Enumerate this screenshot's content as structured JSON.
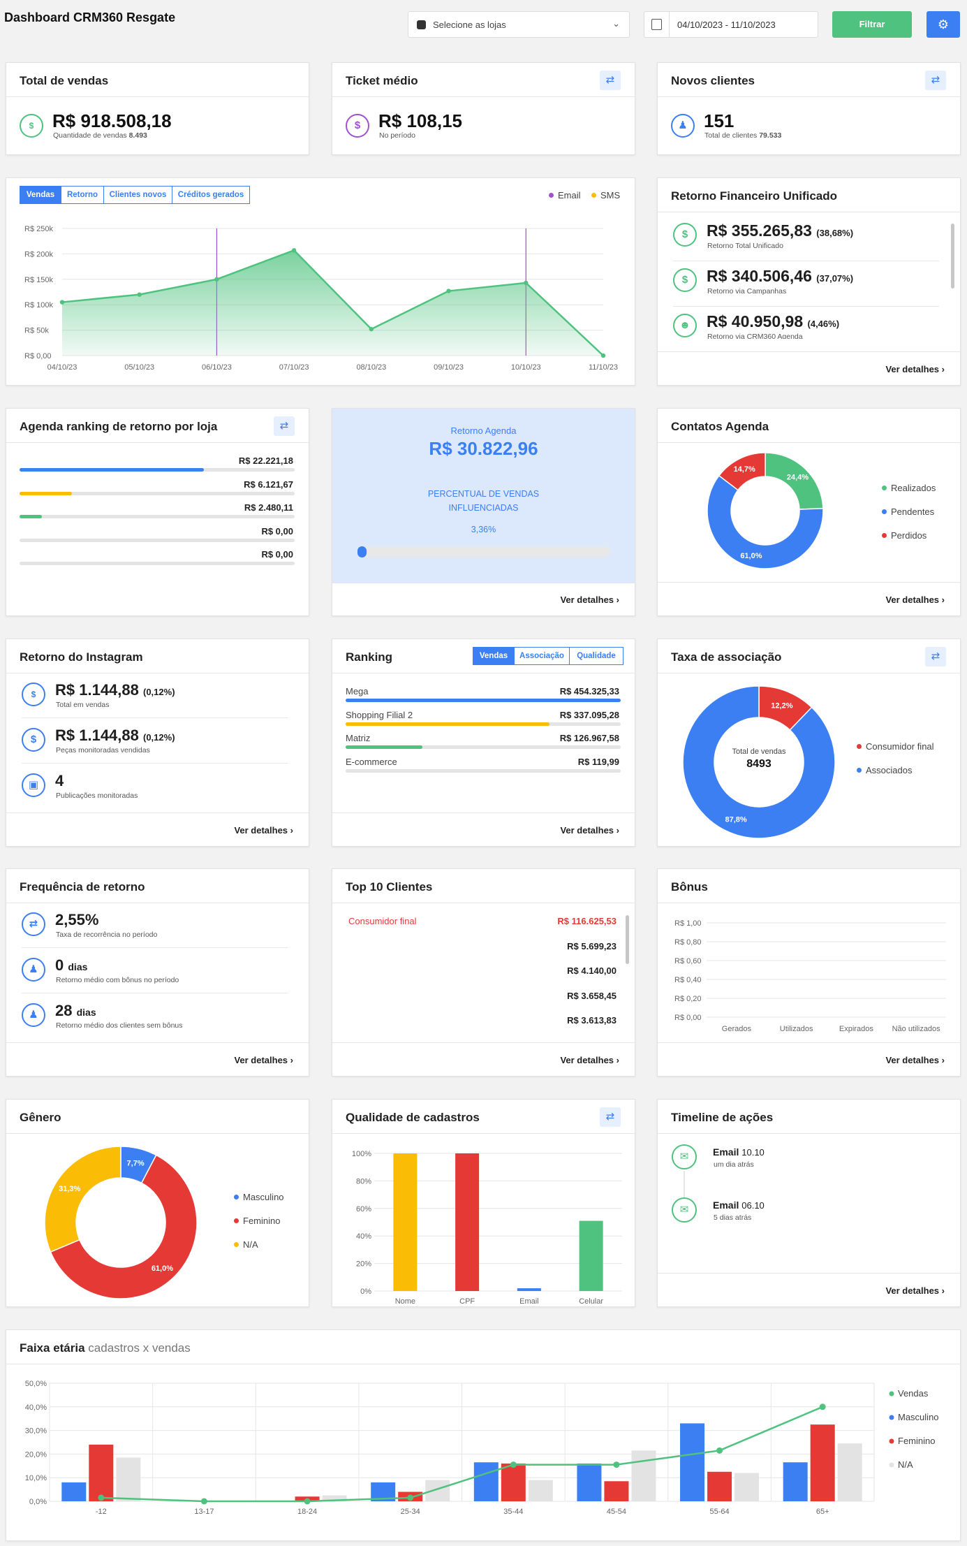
{
  "header": {
    "title": "Dashboard CRM360 Resgate",
    "store_select": "Selecione as lojas",
    "date_range": "04/10/2023 - 11/10/2023",
    "filter_button": "Filtrar"
  },
  "total_vendas": {
    "title": "Total de vendas",
    "value": "R$ 918.508,18",
    "sub_label": "Quantidade de vendas",
    "sub_value": "8.493"
  },
  "ticket": {
    "title": "Ticket médio",
    "value": "R$ 108,15",
    "sub": "No período"
  },
  "novos": {
    "title": "Novos clientes",
    "value": "151",
    "sub_label": "Total de clientes",
    "sub_value": "79.533"
  },
  "vendas_chart": {
    "tabs": [
      "Vendas",
      "Retorno",
      "Clientes novos",
      "Créditos gerados"
    ],
    "legend": [
      "Email",
      "SMS"
    ]
  },
  "retorno_fin": {
    "title": "Retorno Financeiro Unificado",
    "items": [
      {
        "value": "R$ 355.265,83",
        "pct": "(38,68%)",
        "label": "Retorno Total Unificado"
      },
      {
        "value": "R$ 340.506,46",
        "pct": "(37,07%)",
        "label": "Retorno via Campanhas"
      },
      {
        "value": "R$ 40.950,98",
        "pct": "(4,46%)",
        "label": "Retorno via CRM360 Agenda"
      }
    ],
    "more": "Ver detalhes"
  },
  "agenda_rank": {
    "title": "Agenda ranking de retorno por loja",
    "rows": [
      {
        "value": "R$ 22.221,18",
        "pct": 67,
        "color": "#3b7ff2"
      },
      {
        "value": "R$ 6.121,67",
        "pct": 19,
        "color": "#fbbc05"
      },
      {
        "value": "R$ 2.480,11",
        "pct": 8,
        "color": "#4ec27e"
      },
      {
        "value": "R$ 0,00",
        "pct": 0,
        "color": "#3b7ff2"
      },
      {
        "value": "R$ 0,00",
        "pct": 0,
        "color": "#3b7ff2"
      }
    ]
  },
  "retorno_agenda": {
    "label": "Retorno Agenda",
    "value": "R$ 30.822,96",
    "pct_label_1": "PERCENTUAL DE VENDAS",
    "pct_label_2": "INFLUENCIADAS",
    "pct": "3,36%",
    "more": "Ver detalhes"
  },
  "contatos": {
    "title": "Contatos Agenda",
    "legend": [
      "Realizados",
      "Pendentes",
      "Perdidos"
    ],
    "labels": [
      "24,4%",
      "61,0%",
      "14,7%"
    ],
    "more": "Ver detalhes"
  },
  "instagram": {
    "title": "Retorno do Instagram",
    "items": [
      {
        "value": "R$ 1.144,88",
        "pct": "(0,12%)",
        "label": "Total em vendas"
      },
      {
        "value": "R$ 1.144,88",
        "pct": "(0,12%)",
        "label": "Peças monitoradas vendidas"
      },
      {
        "value": "4",
        "pct": "",
        "label": "Publicações monitoradas"
      }
    ],
    "more": "Ver detalhes"
  },
  "ranking": {
    "title": "Ranking",
    "tabs": [
      "Vendas",
      "Associação",
      "Qualidade"
    ],
    "rows": [
      {
        "name": "Mega",
        "value": "R$ 454.325,33",
        "pct": 100,
        "color": "#3b7ff2"
      },
      {
        "name": "Shopping Filial 2",
        "value": "R$ 337.095,28",
        "pct": 74,
        "color": "#fbbc05"
      },
      {
        "name": "Matriz",
        "value": "R$ 126.967,58",
        "pct": 28,
        "color": "#4ec27e"
      },
      {
        "name": "E-commerce",
        "value": "R$ 119,99",
        "pct": 0,
        "color": "#3b7ff2"
      }
    ],
    "more": "Ver detalhes"
  },
  "taxa": {
    "title": "Taxa de associação",
    "center_label": "Total de vendas",
    "center_value": "8493",
    "legend": [
      "Consumidor final",
      "Associados"
    ],
    "labels": [
      "12,2%",
      "87,8%"
    ]
  },
  "frequencia": {
    "title": "Frequência de retorno",
    "items": [
      {
        "value": "2,55%",
        "unit": "",
        "label": "Taxa de recorrência no período"
      },
      {
        "value": "0",
        "unit": "dias",
        "label": "Retorno médio com bônus no período"
      },
      {
        "value": "28",
        "unit": "dias",
        "label": "Retorno médio dos clientes sem bônus"
      }
    ],
    "more": "Ver detalhes"
  },
  "top10": {
    "title": "Top 10 Clientes",
    "rows": [
      {
        "name": "Consumidor final",
        "value": "R$ 116.625,53"
      },
      {
        "name": "",
        "value": "R$ 5.699,23"
      },
      {
        "name": "",
        "value": "R$ 4.140,00"
      },
      {
        "name": "",
        "value": "R$ 3.658,45"
      },
      {
        "name": "",
        "value": "R$ 3.613,83"
      }
    ],
    "more": "Ver detalhes"
  },
  "bonus": {
    "title": "Bônus",
    "more": "Ver detalhes"
  },
  "genero": {
    "title": "Gênero",
    "legend": [
      "Masculino",
      "Feminino",
      "N/A"
    ],
    "labels": [
      "7,7%",
      "61,0%",
      "31,3%"
    ]
  },
  "qualidade": {
    "title": "Qualidade de cadastros"
  },
  "timeline": {
    "title": "Timeline de ações",
    "items": [
      {
        "title": "Email",
        "date": "10.10",
        "sub": "um dia atrás"
      },
      {
        "title": "Email",
        "date": "06.10",
        "sub": "5 dias atrás"
      }
    ],
    "more": "Ver detalhes"
  },
  "faixa": {
    "title": "Faixa etária",
    "subtitle": "cadastros x vendas"
  },
  "chart_data": [
    {
      "type": "area",
      "x": [
        "04/10/23",
        "05/10/23",
        "06/10/23",
        "07/10/23",
        "08/10/23",
        "09/10/23",
        "10/10/23",
        "11/10/23"
      ],
      "values": [
        105000,
        120000,
        150000,
        207000,
        52000,
        127000,
        143000,
        0
      ],
      "ylim": [
        0,
        250000
      ],
      "yticks": [
        "R$ 0,00",
        "R$ 50k",
        "R$ 100k",
        "R$ 150k",
        "R$ 200k",
        "R$ 250k"
      ],
      "markers": [
        {
          "x": "06/10/23",
          "series": "Email"
        },
        {
          "x": "10/10/23",
          "series": "Email"
        }
      ]
    },
    {
      "type": "pie",
      "title": "Contatos Agenda",
      "categories": [
        "Realizados",
        "Pendentes",
        "Perdidos"
      ],
      "values": [
        24.4,
        61.0,
        14.7
      ],
      "colors": [
        "#4ec27e",
        "#3b7ff2",
        "#e53935"
      ]
    },
    {
      "type": "pie",
      "title": "Taxa de associação",
      "categories": [
        "Consumidor final",
        "Associados"
      ],
      "values": [
        12.2,
        87.8
      ],
      "colors": [
        "#e53935",
        "#3b7ff2"
      ]
    },
    {
      "type": "bar",
      "title": "Bônus",
      "categories": [
        "Gerados",
        "Utilizados",
        "Expirados",
        "Não utilizados"
      ],
      "values": [
        0,
        0,
        0,
        0
      ],
      "yticks": [
        "R$ 0,00",
        "R$ 0,20",
        "R$ 0,40",
        "R$ 0,60",
        "R$ 0,80",
        "R$ 1,00"
      ]
    },
    {
      "type": "pie",
      "title": "Gênero",
      "categories": [
        "Masculino",
        "Feminino",
        "N/A"
      ],
      "values": [
        7.7,
        61.0,
        31.3
      ],
      "colors": [
        "#3b7ff2",
        "#e53935",
        "#fbbc05"
      ]
    },
    {
      "type": "bar",
      "title": "Qualidade de cadastros",
      "categories": [
        "Nome",
        "CPF",
        "Email",
        "Celular"
      ],
      "values": [
        100,
        100,
        2,
        51
      ],
      "colors": [
        "#fbbc05",
        "#e53935",
        "#3b7ff2",
        "#4ec27e"
      ],
      "ylim": [
        0,
        100
      ],
      "yticks": [
        "0%",
        "20%",
        "40%",
        "60%",
        "80%",
        "100%"
      ]
    },
    {
      "type": "bar",
      "title": "Faixa etária",
      "categories": [
        "-12",
        "13-17",
        "18-24",
        "25-34",
        "35-44",
        "45-54",
        "55-64",
        "65+"
      ],
      "ylim": [
        0,
        50
      ],
      "yticks": [
        "0,0%",
        "10,0%",
        "20,0%",
        "30,0%",
        "40,0%",
        "50,0%"
      ],
      "series": [
        {
          "name": "Masculino",
          "values": [
            8,
            0,
            0,
            8,
            16.5,
            16,
            33,
            16.5
          ],
          "color": "#3b7ff2"
        },
        {
          "name": "Feminino",
          "values": [
            24,
            0,
            2,
            4,
            16,
            8.5,
            12.5,
            32.5
          ],
          "color": "#e53935"
        },
        {
          "name": "N/A",
          "values": [
            18.5,
            0,
            2.5,
            9,
            9,
            21.5,
            12,
            24.5
          ],
          "color": "#e3e3e3"
        },
        {
          "name": "Vendas",
          "type": "line",
          "values": [
            1.5,
            0,
            0,
            1.5,
            15.5,
            15.5,
            21.5,
            40
          ],
          "color": "#4ec27e"
        }
      ]
    }
  ]
}
